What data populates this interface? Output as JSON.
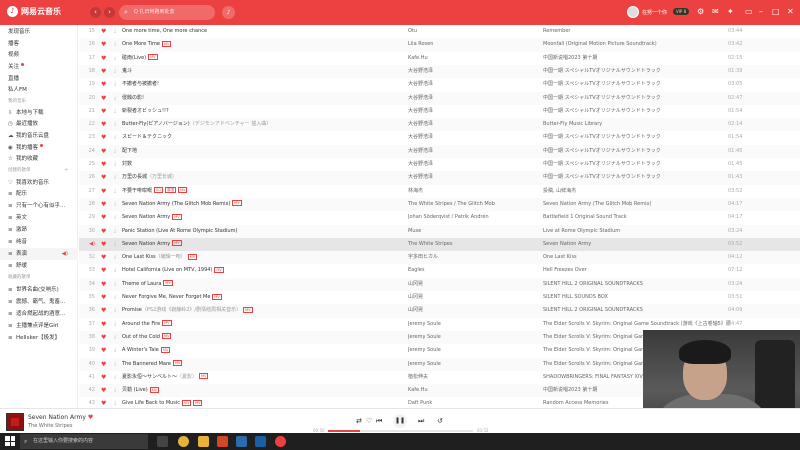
{
  "app": {
    "name": "网易云音乐",
    "logo_glyph": "♪"
  },
  "titlebar": {
    "search_placeholder": "Q 扎日何跑到处去",
    "user_name": "在努一个你",
    "vip_badge": "VIP 8",
    "icons": [
      "back-icon",
      "forward-icon",
      "search-icon",
      "mic-icon",
      "settings-icon",
      "mail-icon",
      "skin-icon",
      "minimize-icon",
      "mini-mode-icon",
      "maximize-icon",
      "close-icon"
    ]
  },
  "sidebar": {
    "items": [
      {
        "label": "发现音乐",
        "type": "nav"
      },
      {
        "label": "播客",
        "type": "nav"
      },
      {
        "label": "视频",
        "type": "nav"
      },
      {
        "label": "关注",
        "type": "nav",
        "dot": true
      },
      {
        "label": "直播",
        "type": "nav"
      },
      {
        "label": "私人FM",
        "type": "nav"
      },
      {
        "label": "我的音乐",
        "type": "head"
      },
      {
        "label": "本地与下载",
        "type": "mine",
        "icon": "⇩"
      },
      {
        "label": "最近播放",
        "type": "mine",
        "icon": "◷"
      },
      {
        "label": "我的音乐云盘",
        "type": "mine",
        "icon": "☁"
      },
      {
        "label": "我的播客",
        "type": "mine",
        "icon": "◉",
        "dot": true
      },
      {
        "label": "我的收藏",
        "type": "mine",
        "icon": "☆"
      },
      {
        "label": "创建的歌单",
        "type": "head",
        "plus": "+"
      },
      {
        "label": "我喜欢的音乐",
        "type": "list",
        "icon": "♡"
      },
      {
        "label": "配乐",
        "type": "list",
        "icon": "≡"
      },
      {
        "label": "只有一个心有似乎...",
        "type": "list",
        "icon": "≡"
      },
      {
        "label": "英文",
        "type": "list",
        "icon": "≡"
      },
      {
        "label": "激昂",
        "type": "list",
        "icon": "≡"
      },
      {
        "label": "纯音",
        "type": "list",
        "icon": "≡"
      },
      {
        "label": "表演",
        "type": "list",
        "icon": "≡",
        "active": true
      },
      {
        "label": "舒缓",
        "type": "list",
        "icon": "≡"
      },
      {
        "label": "收藏的歌单",
        "type": "head"
      },
      {
        "label": "世界名曲(交响乐)",
        "type": "list",
        "icon": "≡"
      },
      {
        "label": "震撼、霸气、鬼畜...",
        "type": "list",
        "icon": "≡"
      },
      {
        "label": "适合燃起战的酒意...",
        "type": "list",
        "icon": "≡"
      },
      {
        "label": "主播兼点评是Girl",
        "type": "list",
        "icon": "≡"
      },
      {
        "label": "Hellsker【极发】",
        "type": "list",
        "icon": "≡"
      }
    ]
  },
  "songs": [
    {
      "num": "15",
      "title": "One more time, One more chance",
      "alias": "",
      "tags": [],
      "artist": "Otu",
      "album": "Remember",
      "duration": "03:44"
    },
    {
      "num": "16",
      "title": "One More Time",
      "alias": "",
      "tags": [
        "MV"
      ],
      "artist": "Lila Rosen",
      "album": "Moonfall (Original Motion Picture Soundtrack)",
      "duration": "03:42"
    },
    {
      "num": "17",
      "title": "碰雨(Live)",
      "alias": "",
      "tags": [
        "MV"
      ],
      "artist": "Kafe.Hu",
      "album": "中国新说唱2023 第十期",
      "duration": "02:15"
    },
    {
      "num": "18",
      "title": "鬼斗",
      "alias": "",
      "tags": [],
      "artist": "大谷野浩泽",
      "album": "中国一期 スペシャルTVオリジナルサウンドトラック",
      "duration": "01:39"
    },
    {
      "num": "19",
      "title": "不撤者与被撤者!",
      "alias": "",
      "tags": [],
      "artist": "大谷野浩泽",
      "album": "中国一期 スペシャルTVオリジナルサウンドトラック",
      "duration": "03:05"
    },
    {
      "num": "20",
      "title": "侵蝕の影!",
      "alias": "",
      "tags": [],
      "artist": "大谷野浩泽",
      "album": "中国一期 スペシャルTVオリジナルサウンドトラック",
      "duration": "02:47"
    },
    {
      "num": "21",
      "title": "斩裂者オビッシュ!!?",
      "alias": "",
      "tags": [],
      "artist": "大谷野浩泽",
      "album": "中国一期 スペシャルTVオリジナルサウンドトラック",
      "duration": "01:54"
    },
    {
      "num": "22",
      "title": "Butter-Fly(ピアノバージョン)",
      "alias": "（デジモンアドベンチャー 插入曲）",
      "tags": [],
      "artist": "大谷野浩泽",
      "album": "Butter-Fly Music Library",
      "duration": "02:14"
    },
    {
      "num": "23",
      "title": "スピード＆テクニック",
      "alias": "",
      "tags": [],
      "artist": "大谷野浩泽",
      "album": "中国一期 スペシャルTVオリジナルサウンドトラック",
      "duration": "01:54"
    },
    {
      "num": "24",
      "title": "配下地",
      "alias": "",
      "tags": [],
      "artist": "大谷野浩泽",
      "album": "中国一期 スペシャルTVオリジナルサウンドトラック",
      "duration": "01:45"
    },
    {
      "num": "25",
      "title": "対数",
      "alias": "",
      "tags": [],
      "artist": "大谷野浩泽",
      "album": "中国一期 スペシャルTVオリジナルサウンドトラック",
      "duration": "01:45"
    },
    {
      "num": "26",
      "title": "万里の長城",
      "alias": "（万里长城）",
      "tags": [],
      "artist": "大谷野浩泽",
      "album": "中国一期 スペシャルTVオリジナルサウンドトラック",
      "duration": "01:43"
    },
    {
      "num": "27",
      "title": "不要干啡咁嘅",
      "alias": "",
      "tags": [
        "SQ",
        "原唱",
        "MV"
      ],
      "artist": "林海杰",
      "album": "投稿, 山鲜海杰",
      "duration": "03:52"
    },
    {
      "num": "28",
      "title": "Seven Nation Army (The Glitch Mob Remix)",
      "alias": "",
      "tags": [
        "MV"
      ],
      "artist": "The White Stripes / The Glitch Mob",
      "album": "Seven Nation Army (The Glitch Mob Remix)",
      "duration": "04:17"
    },
    {
      "num": "29",
      "title": "Seven Nation Army",
      "alias": "",
      "tags": [
        "MV"
      ],
      "artist": "Johan Söderqvist / Patrik Andrén",
      "album": "Battlefield 1 Original Sound Track",
      "duration": "04:17"
    },
    {
      "num": "30",
      "title": "Panic Station (Live At Rome Olympic Stadium)",
      "alias": "",
      "tags": [],
      "artist": "Muse",
      "album": "Live at Rome Olympic Stadium",
      "duration": "03:24"
    },
    {
      "num": "31",
      "title": "Seven Nation Army",
      "alias": "",
      "tags": [
        "MV"
      ],
      "artist": "The White Stripes",
      "album": "Seven Nation Army",
      "duration": "03:52",
      "playing": true
    },
    {
      "num": "32",
      "title": "One Last Kiss",
      "alias": "（编辑一吻）",
      "tags": [
        "MV"
      ],
      "artist": "宇多田ヒカル",
      "album": "One Last Kiss",
      "duration": "04:12"
    },
    {
      "num": "33",
      "title": "Hotel California (Live on MTV, 1994)",
      "alias": "",
      "tags": [
        "MV"
      ],
      "artist": "Eagles",
      "album": "Hell Freezes Over",
      "duration": "07:12"
    },
    {
      "num": "34",
      "title": "Theme of Laura",
      "alias": "",
      "tags": [
        "MV"
      ],
      "artist": "山冈晃",
      "album": "SILENT HILL 2 ORIGINAL SOUNDTRACKS",
      "duration": "03:24"
    },
    {
      "num": "35",
      "title": "Never Forgive Me, Never Forget Me",
      "alias": "",
      "tags": [
        "MV"
      ],
      "artist": "山冈晃",
      "album": "SILENT HILL SOUNDS BOX",
      "duration": "03:51"
    },
    {
      "num": "36",
      "title": "Promise",
      "alias": "（PS2游戏《寂静岭2》/剧情结局相关音乐）",
      "tags": [
        "MV"
      ],
      "artist": "山冈晃",
      "album": "SILENT HILL 2 ORIGINAL SOUNDTRACKS",
      "duration": "04:09"
    },
    {
      "num": "37",
      "title": "Around the Fire",
      "alias": "",
      "tags": [
        "MV"
      ],
      "artist": "Jeremy Soule",
      "album": "The Elder Scrolls V: Skyrim: Original Game Soundtrack (游戏《上古卷轴5》原",
      "duration": "04:47"
    },
    {
      "num": "38",
      "title": "Out of the Cold",
      "alias": "",
      "tags": [
        "MV"
      ],
      "artist": "Jeremy Soule",
      "album": "The Elder Scrolls V: Skyrim: Original Game",
      "duration": "03:41"
    },
    {
      "num": "39",
      "title": "A Winter's Tale",
      "alias": "",
      "tags": [
        "MV"
      ],
      "artist": "Jeremy Soule",
      "album": "The Elder Scrolls V: Skyrim: Original Game",
      "duration": "03:50"
    },
    {
      "num": "40",
      "title": "The Bannered Mare",
      "alias": "",
      "tags": [
        "MV"
      ],
      "artist": "Jeremy Soule",
      "album": "The Elder Scrolls V: Skyrim: Original Game",
      "duration": "03:38"
    },
    {
      "num": "41",
      "title": "夏影永恒～サンベルト～",
      "alias": "（夏影）",
      "tags": [
        "MV"
      ],
      "artist": "植松伸夫",
      "album": "SHADOWBRINGERS: FINAL FANTASY XIV",
      "duration": "03:32"
    },
    {
      "num": "42",
      "title": "贝勒 (Live)",
      "alias": "",
      "tags": [
        "MV"
      ],
      "artist": "Kafe.Hu",
      "album": "中国新说唱2023 第十期",
      "duration": "02:46"
    },
    {
      "num": "43",
      "title": "Give Life Back to Music",
      "alias": "",
      "tags": [
        "SQ",
        "MV"
      ],
      "artist": "Daft Punk",
      "album": "Random Access Memories",
      "duration": "04:34"
    }
  ],
  "player": {
    "title": "Seven Nation Army",
    "artist": "The White Stripes",
    "current_time": "00:50",
    "total_time": "03:52",
    "progress": 0.22,
    "controls": [
      "shuffle-icon",
      "heart-icon",
      "prev-icon",
      "pause-icon",
      "next-icon",
      "playlist-mode-icon"
    ]
  },
  "taskbar": {
    "search_placeholder": "在这里输入你要搜索的内容",
    "apps": [
      {
        "name": "task-view",
        "color": "#444444"
      },
      {
        "name": "chrome",
        "color": "#e6b33a"
      },
      {
        "name": "explorer",
        "color": "#e8b13a"
      },
      {
        "name": "office",
        "color": "#d24726"
      },
      {
        "name": "media",
        "color": "#2b6cb0"
      },
      {
        "name": "steam",
        "color": "#1b5fa3"
      },
      {
        "name": "netease",
        "color": "#ec4141"
      }
    ]
  },
  "colors": {
    "accent": "#ec4141",
    "titlebar": "#ec4141",
    "playing_row": "#e6e6e6"
  }
}
